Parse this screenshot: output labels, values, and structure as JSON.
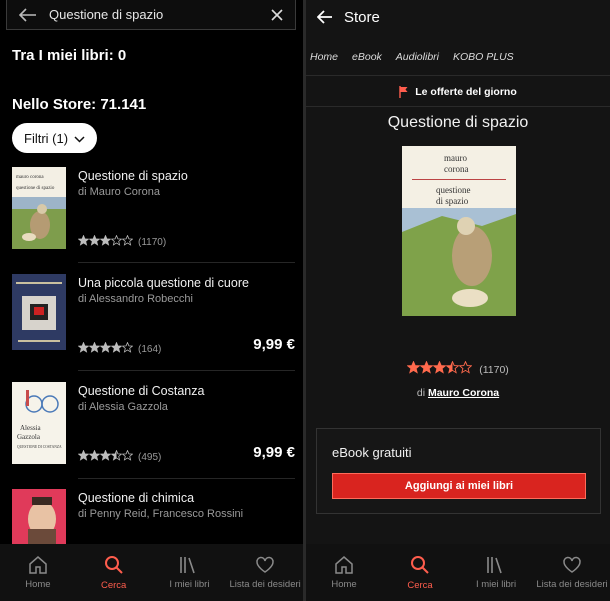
{
  "left": {
    "search": {
      "query": "Questione di spazio"
    },
    "my_books_heading": "Tra I miei libri: 0",
    "store_heading": "Nello Store: 71.141",
    "filters_label": "Filtri  (1)",
    "results": [
      {
        "title": "Questione di spazio",
        "author": "di Mauro Corona",
        "stars": 3,
        "count": "(1170)",
        "price": ""
      },
      {
        "title": "Una piccola questione di cuore",
        "author": "di Alessandro Robecchi",
        "stars": 4,
        "count": "(164)",
        "price": "9,99 €"
      },
      {
        "title": "Questione di Costanza",
        "author": "di Alessia Gazzola",
        "stars": 3.5,
        "count": "(495)",
        "price": "9,99 €"
      },
      {
        "title": "Questione di chimica",
        "author": "di Penny Reid, Francesco Rossini",
        "stars": 0,
        "count": "",
        "price": ""
      }
    ],
    "cover_texts": {
      "book1_author": "mauro corona",
      "book1_title": "questione di spazio",
      "book3_author1": "Alessia",
      "book3_author2": "Gazzola",
      "book3_title": "QUESTIONE DI COSTANZA"
    }
  },
  "right": {
    "header_title": "Store",
    "tabs": [
      "Home",
      "eBook",
      "Audiolibri",
      "KOBO PLUS"
    ],
    "deal_label": "Le offerte del giorno",
    "book_title": "Questione di spazio",
    "cover_author_1": "mauro",
    "cover_author_2": "corona",
    "cover_title_1": "questione",
    "cover_title_2": "di spazio",
    "rating_count": "(1170)",
    "rating_value": 3.5,
    "author_prefix": "di",
    "author_name": "Mauro Corona",
    "box_label": "eBook gratuiti",
    "add_button": "Aggiungi ai miei libri"
  },
  "nav": [
    "Home",
    "Cerca",
    "I miei libri",
    "Lista dei desideri"
  ],
  "colors": {
    "accent": "#ff5d4d",
    "button_red": "#d9241f",
    "star": "#ff6a4d"
  }
}
